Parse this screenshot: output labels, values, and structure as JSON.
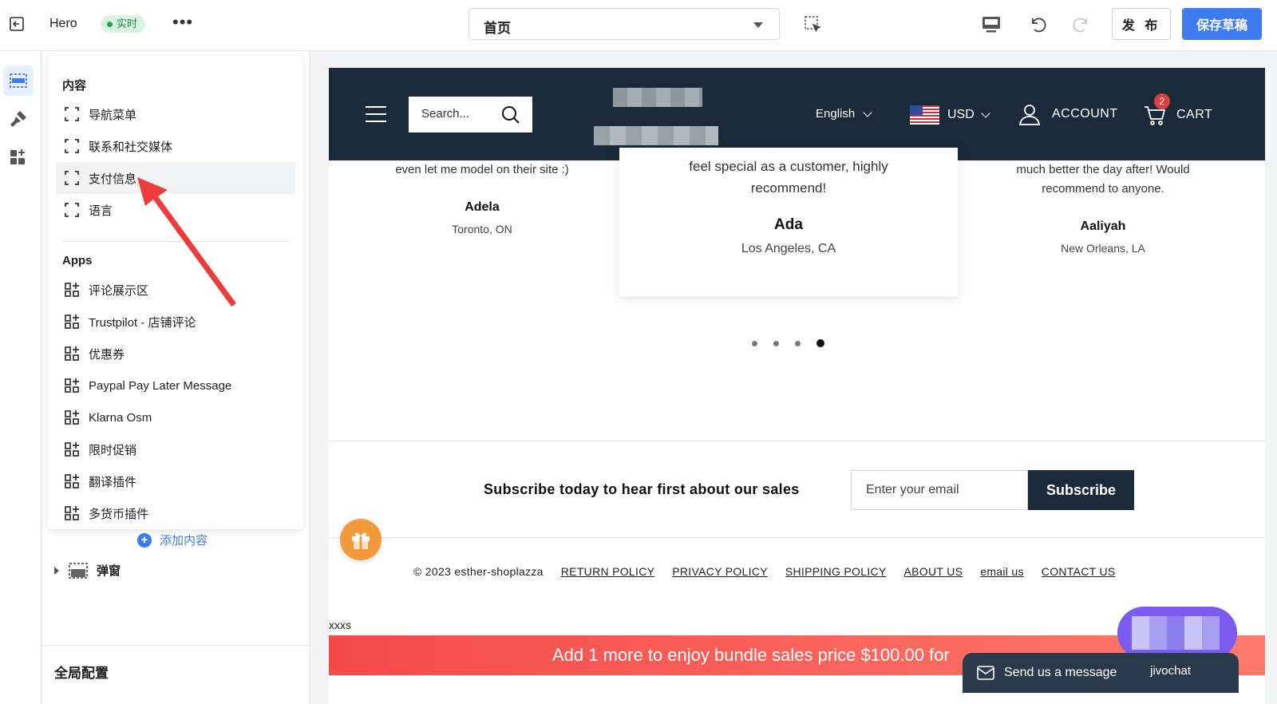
{
  "topbar": {
    "title": "Hero",
    "status_badge": "实时",
    "page_select": "首页",
    "publish_label": "发 布",
    "save_label": "保存草稿"
  },
  "sidebar": {
    "content_header": "内容",
    "content_items": [
      {
        "label": "导航菜单",
        "icon": "section-frame-icon"
      },
      {
        "label": "联系和社交媒体",
        "icon": "section-frame-icon"
      },
      {
        "label": "支付信息",
        "icon": "section-frame-icon"
      },
      {
        "label": "语言",
        "icon": "section-frame-icon"
      }
    ],
    "apps_header": "Apps",
    "app_items": [
      {
        "label": "评论展示区",
        "icon": "app-grid-icon"
      },
      {
        "label": "Trustpilot - 店铺评论",
        "icon": "app-grid-icon"
      },
      {
        "label": "优惠券",
        "icon": "app-grid-icon"
      },
      {
        "label": "Paypal Pay Later Message",
        "icon": "app-grid-icon"
      },
      {
        "label": "Klarna Osm",
        "icon": "app-grid-icon"
      },
      {
        "label": "限时促销",
        "icon": "app-grid-icon"
      },
      {
        "label": "翻译插件",
        "icon": "app-grid-icon"
      },
      {
        "label": "多货币插件",
        "icon": "app-grid-icon"
      }
    ],
    "add_content": "添加内容",
    "popup_section": "弹窗",
    "global_config": "全局配置"
  },
  "preview": {
    "search_placeholder": "Search...",
    "language": "English",
    "currency": "USD",
    "account": "ACCOUNT",
    "cart": "CART",
    "cart_count": "2",
    "testimonials": [
      {
        "quote": "even let me model on their site :)",
        "name": "Adela",
        "location": "Toronto, ON"
      },
      {
        "quote": "feel special as a customer, highly recommend!",
        "name": "Ada",
        "location": "Los Angeles, CA"
      },
      {
        "quote": "much better the day after! Would recommend to anyone.",
        "name": "Aaliyah",
        "location": "New Orleans, LA"
      }
    ],
    "carousel": {
      "total": 4,
      "active": 4
    },
    "subscribe_text": "Subscribe today to hear first about our sales",
    "email_placeholder": "Enter your email",
    "subscribe_button": "Subscribe",
    "copyright": "© 2023 esther-shoplazza",
    "footer_links": [
      "RETURN POLICY",
      "PRIVACY POLICY",
      "SHIPPING POLICY",
      "ABOUT US",
      "email us",
      "CONTACT US"
    ],
    "extra_text": "xxxs",
    "bundle_banner": "Add 1 more to enjoy bundle sales price $100.00 for",
    "chat_label": "Send us a message",
    "chat_brand": "jivochat"
  },
  "colors": {
    "accent": "#3d7bef",
    "store_header": "#1b2a38",
    "live_badge_bg": "#d9f3e1",
    "banner_red": "#f44a4a",
    "annotation_arrow": "#ee3b3b"
  }
}
